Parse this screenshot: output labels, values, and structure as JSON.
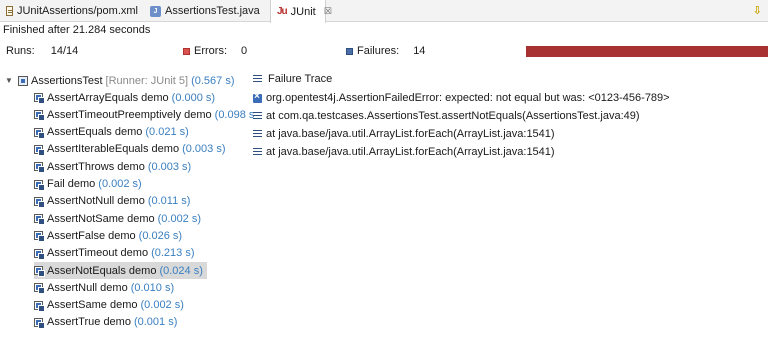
{
  "tabs": [
    {
      "label": "JUnitAssertions/pom.xml",
      "icon": "xml-file-icon"
    },
    {
      "label": "AssertionsTest.java",
      "icon": "java-file-icon"
    },
    {
      "label": "JUnit",
      "icon": "junit-icon",
      "close": "☒"
    }
  ],
  "status": {
    "finished": "Finished after 21.284 seconds"
  },
  "counters": {
    "runs_label": "Runs:",
    "runs_value": "14/14",
    "errors_label": "Errors:",
    "errors_value": "0",
    "failures_label": "Failures:",
    "failures_value": "14"
  },
  "progress": {
    "color": "#a83232",
    "fraction": 1.0
  },
  "tree": {
    "root": {
      "name": "AssertionsTest",
      "runner": "[Runner: JUnit 5]",
      "time": "(0.567 s)"
    },
    "items": [
      {
        "name": "AssertArrayEquals demo",
        "time": "(0.000 s)"
      },
      {
        "name": "AssertTimeoutPreemptively demo",
        "time": "(0.098 s"
      },
      {
        "name": "AssertEquals demo",
        "time": "(0.021 s)"
      },
      {
        "name": "AssertIterableEquals demo",
        "time": "(0.003 s)"
      },
      {
        "name": "AssertThrows demo",
        "time": "(0.003 s)"
      },
      {
        "name": "Fail demo",
        "time": "(0.002 s)"
      },
      {
        "name": "AssertNotNull demo",
        "time": "(0.011 s)"
      },
      {
        "name": "AssertNotSame demo",
        "time": "(0.002 s)"
      },
      {
        "name": "AssertFalse demo",
        "time": "(0.026 s)"
      },
      {
        "name": "AssertTimeout demo",
        "time": "(0.213 s)"
      },
      {
        "name": "AsserNotEquals demo",
        "time": "(0.024 s)",
        "selected": true
      },
      {
        "name": "AssertNull demo",
        "time": "(0.010 s)"
      },
      {
        "name": "AssertSame demo",
        "time": "(0.002 s)"
      },
      {
        "name": "AssertTrue demo",
        "time": "(0.001 s)"
      }
    ]
  },
  "trace": {
    "header": "Failure Trace",
    "lines": [
      "org.opentest4j.AssertionFailedError: expected: not equal but was: <0123-456-789>",
      "at com.qa.testcases.AssertionsTest.assertNotEquals(AssertionsTest.java:49)",
      "at java.base/java.util.ArrayList.forEach(ArrayList.java:1541)",
      "at java.base/java.util.ArrayList.forEach(ArrayList.java:1541)"
    ]
  }
}
